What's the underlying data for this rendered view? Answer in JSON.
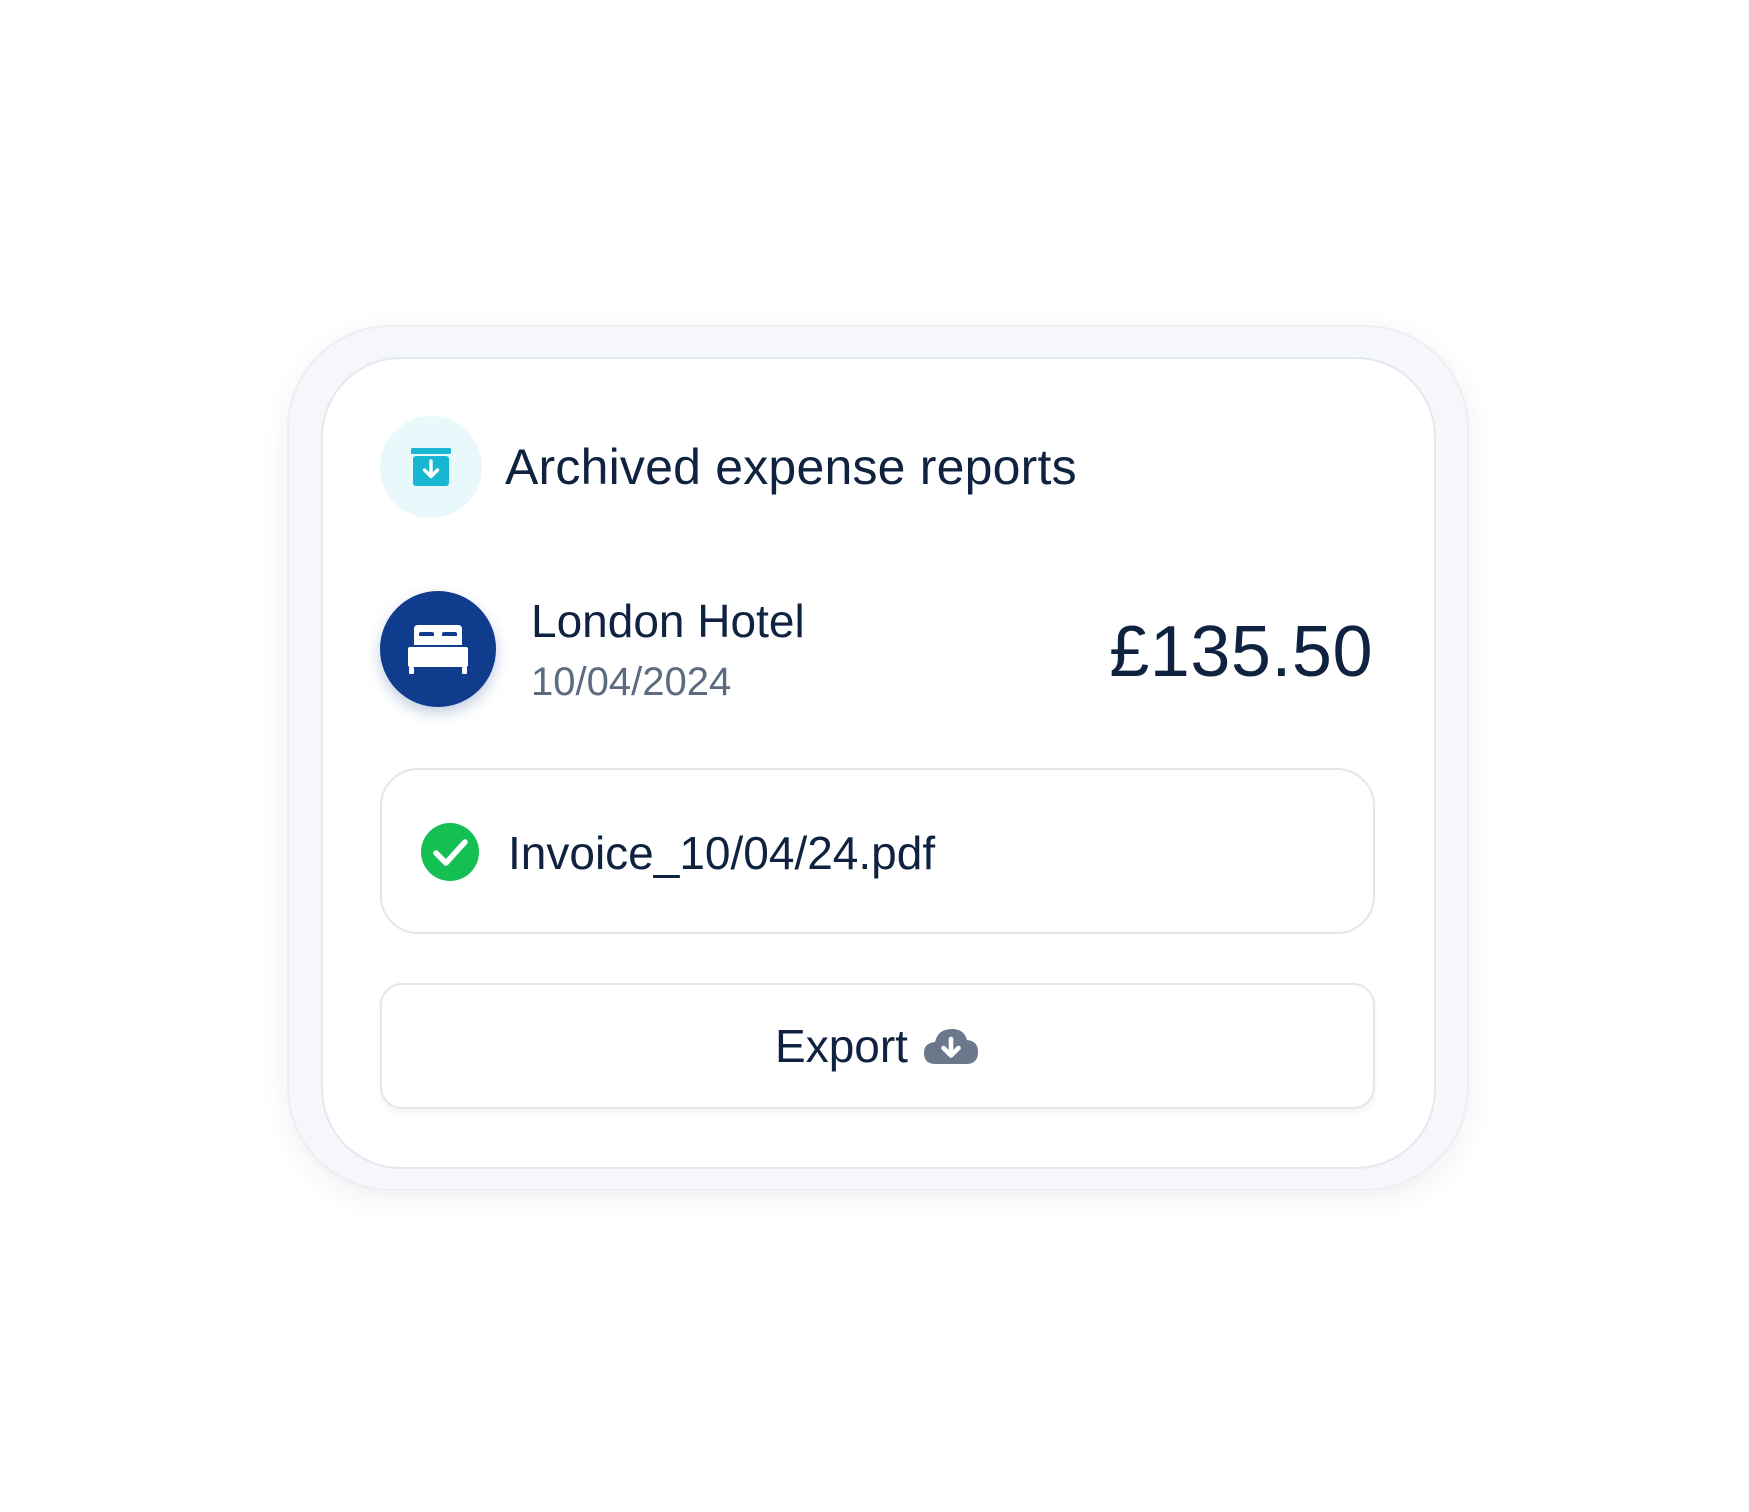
{
  "header": {
    "title": "Archived expense reports",
    "icon": "archive-download-icon",
    "icon_color": "#17b6d2",
    "icon_bg": "#e9f8fb"
  },
  "expense": {
    "merchant": "London Hotel",
    "date": "10/04/2024",
    "amount": "£135.50",
    "icon": "bed-icon",
    "avatar_color": "#0f3c8c"
  },
  "attachment": {
    "file_name": "Invoice_10/04/24.pdf",
    "status_icon": "check-circle-icon",
    "status_color": "#14c052"
  },
  "actions": {
    "export_label": "Export",
    "export_icon": "cloud-download-icon"
  },
  "colors": {
    "text_primary": "#0f2240",
    "text_secondary": "#5d6b80",
    "icon_muted": "#6b778a"
  }
}
